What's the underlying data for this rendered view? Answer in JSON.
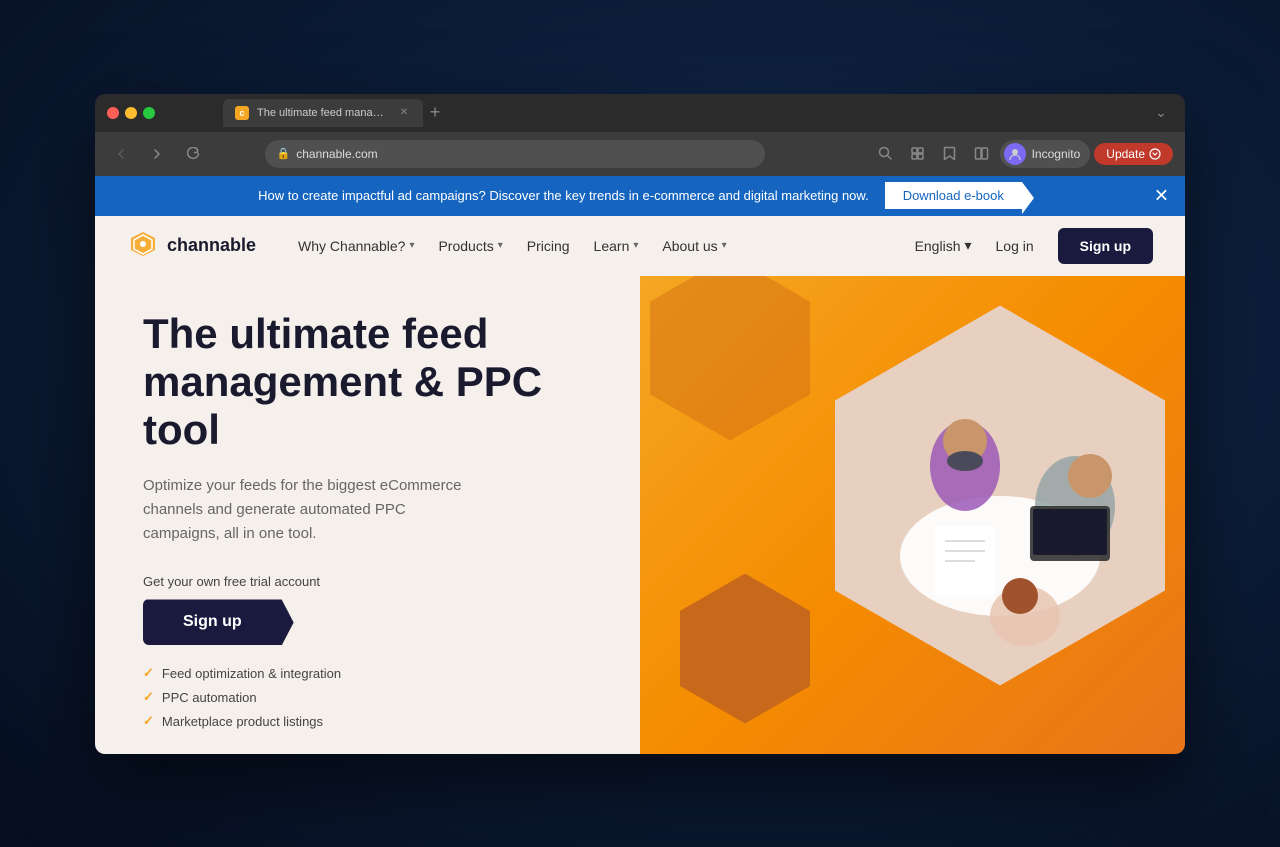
{
  "browser": {
    "tab_title": "The ultimate feed managemen",
    "url": "channable.com",
    "profile_name": "Incognito",
    "update_label": "Update"
  },
  "banner": {
    "text": "How to create impactful ad campaigns? Discover the key trends in e-commerce and digital marketing now.",
    "cta_label": "Download e-book"
  },
  "nav": {
    "logo_text": "channable",
    "links": [
      {
        "label": "Why Channable?",
        "has_dropdown": true
      },
      {
        "label": "Products",
        "has_dropdown": true
      },
      {
        "label": "Pricing",
        "has_dropdown": false
      },
      {
        "label": "Learn",
        "has_dropdown": true
      },
      {
        "label": "About us",
        "has_dropdown": true
      }
    ],
    "language": "English",
    "login_label": "Log in",
    "signup_label": "Sign up"
  },
  "hero": {
    "title": "The ultimate feed management & PPC tool",
    "subtitle": "Optimize your feeds for the biggest eCommerce channels and generate automated PPC campaigns, all in one tool.",
    "trial_label": "Get your own free trial account",
    "signup_btn": "Sign up",
    "features": [
      "Feed optimization & integration",
      "PPC automation",
      "Marketplace product listings"
    ]
  }
}
